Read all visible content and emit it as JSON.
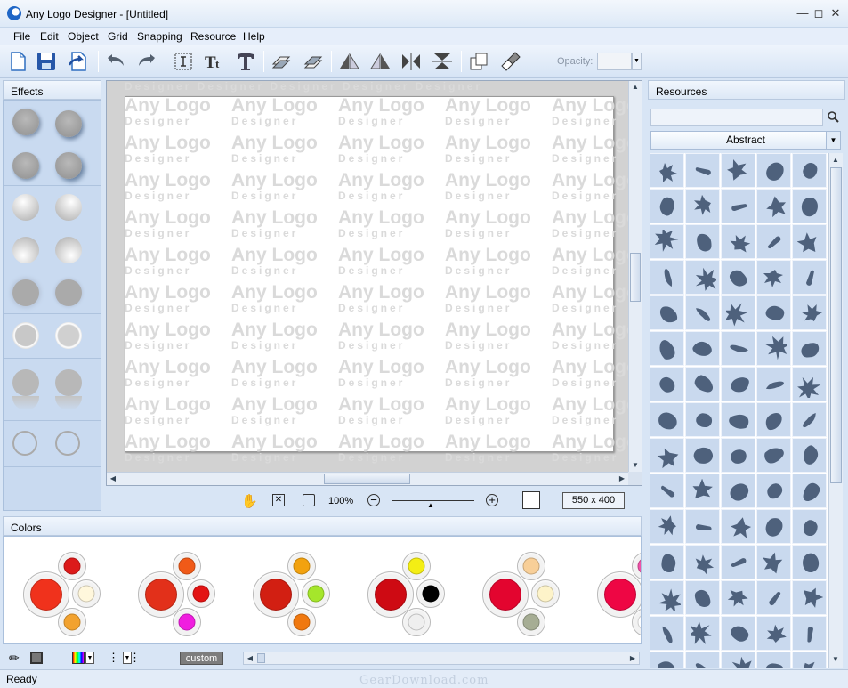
{
  "window": {
    "title": "Any Logo Designer - [Untitled]"
  },
  "menu": {
    "items": [
      "File",
      "Edit",
      "Object",
      "Grid",
      "Snapping",
      "Resource",
      "Help"
    ]
  },
  "toolbar": {
    "buttons": [
      "new",
      "save",
      "export",
      "undo",
      "redo",
      "text-frame",
      "text",
      "text-warp",
      "send-back",
      "bring-front",
      "flip-left",
      "flip-right",
      "mirror-h",
      "mirror-v",
      "copy-style",
      "paint"
    ],
    "opacity_label": "Opacity:"
  },
  "effects": {
    "title": "Effects"
  },
  "canvas": {
    "watermark_top": "Any Logo",
    "watermark_bottom": "Designer"
  },
  "zoom": {
    "level": "100%",
    "size": "550 x 400"
  },
  "colors": {
    "title": "Colors",
    "custom_label": "custom",
    "groups": [
      {
        "main": "#f0321c",
        "top": "#dc1a1a",
        "right": "#fff7dc",
        "bottom": "#f2a22f"
      },
      {
        "main": "#e2301a",
        "top": "#f05a18",
        "right": "#e31313",
        "bottom": "#f01edf"
      },
      {
        "main": "#d21f12",
        "top": "#f2a20f",
        "right": "#a5e62b",
        "bottom": "#f0780f"
      },
      {
        "main": "#ce0a13",
        "top": "#f4ee14",
        "right": "#000000",
        "bottom": "#efefef"
      },
      {
        "main": "#e3052f",
        "top": "#f8cf98",
        "right": "#fdf3c9",
        "bottom": "#a6ad94"
      },
      {
        "main": "#ee0644",
        "top": "#f052a8",
        "right": "#ffffff",
        "bottom": "#ffffff"
      }
    ]
  },
  "resources": {
    "title": "Resources",
    "category": "Abstract",
    "shape_color": "#4e617c"
  },
  "status": {
    "text": "Ready"
  },
  "watermark": {
    "text": "GearDownload.com"
  }
}
